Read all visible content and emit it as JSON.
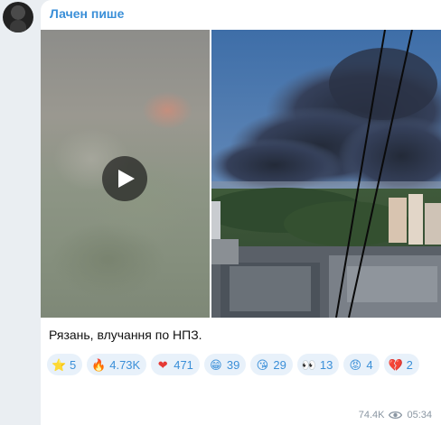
{
  "post": {
    "author": "Лачен пише",
    "caption": "Рязань, влучання по НПЗ."
  },
  "reactions": [
    {
      "icon": "star-icon",
      "glyph": "⭐",
      "count": "5"
    },
    {
      "icon": "fire-emoji-icon",
      "glyph": "🔥",
      "count": "4.73K"
    },
    {
      "icon": "heart-emoji-icon",
      "glyph": "❤",
      "count": "471"
    },
    {
      "icon": "grin-emoji-icon",
      "glyph": "😁",
      "count": "39"
    },
    {
      "icon": "kiss-emoji-icon",
      "glyph": "😘",
      "count": "29"
    },
    {
      "icon": "eyes-emoji-icon",
      "glyph": "👀",
      "count": "13"
    },
    {
      "icon": "angry-emoji-icon",
      "glyph": "😡",
      "count": "4"
    },
    {
      "icon": "broken-heart-emoji-icon",
      "glyph": "💔",
      "count": "2"
    }
  ],
  "meta": {
    "views": "74.4K",
    "time": "05:34"
  },
  "colors": {
    "accent": "#3a8fd8",
    "reaction_bg": "#e8f1fa",
    "background": "#eaeef2"
  }
}
